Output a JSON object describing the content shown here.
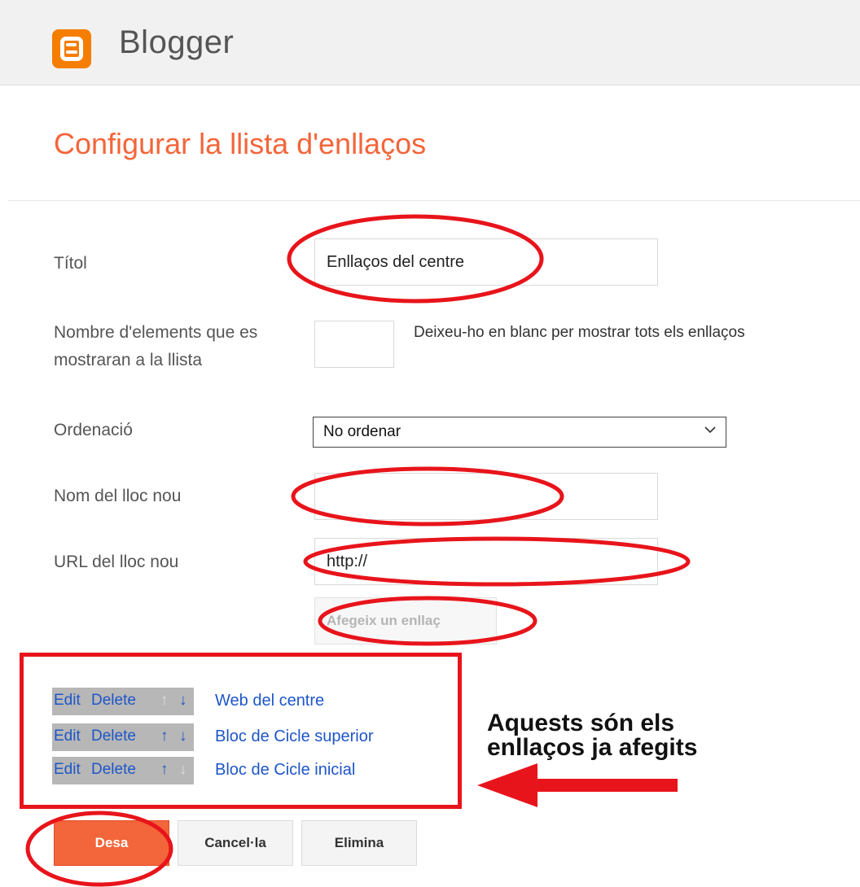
{
  "header": {
    "brand": "Blogger",
    "logo_icon": "blogger-logo-icon"
  },
  "page": {
    "title": "Configurar la llista d'enllaços"
  },
  "form": {
    "title_label": "Títol",
    "title_value": "Enllaços del centre",
    "count_label": "Nombre d'elements que es mostraran a la llista",
    "count_value": "",
    "count_hint": "Deixeu-ho en blanc per mostrar tots els enllaços",
    "sort_label": "Ordenació",
    "sort_value": "No ordenar",
    "new_name_label": "Nom del lloc nou",
    "new_name_value": "",
    "new_url_label": "URL del lloc nou",
    "new_url_value": "http://",
    "add_link_button": "Afegeix un enllaç"
  },
  "links": {
    "edit_label": "Edit",
    "delete_label": "Delete",
    "up_symbol": "↑",
    "down_symbol": "↓",
    "items": [
      {
        "name": "Web del centre"
      },
      {
        "name": "Bloc de Cicle superior"
      },
      {
        "name": "Bloc de Cicle inicial"
      }
    ]
  },
  "annotation": {
    "line1": "Aquests són els",
    "line2": "enllaços ja afegits",
    "highlight_color": "#e8141b"
  },
  "actions": {
    "save": "Desa",
    "cancel": "Cancel·la",
    "delete": "Elimina"
  },
  "colors": {
    "accent": "#f3653a",
    "link": "#1e56c8",
    "brand": "#f57d00"
  }
}
